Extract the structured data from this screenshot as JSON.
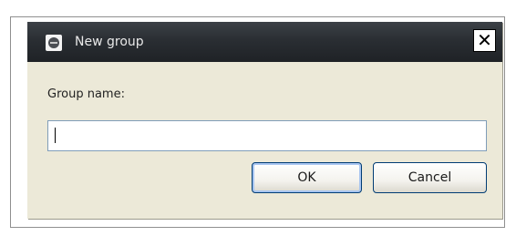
{
  "dialog": {
    "title": "New group",
    "close_label": "✕",
    "field_label": "Group name:",
    "input_value": "",
    "ok_label": "OK",
    "cancel_label": "Cancel"
  },
  "icons": {
    "app": "app-icon",
    "close": "close-icon"
  }
}
